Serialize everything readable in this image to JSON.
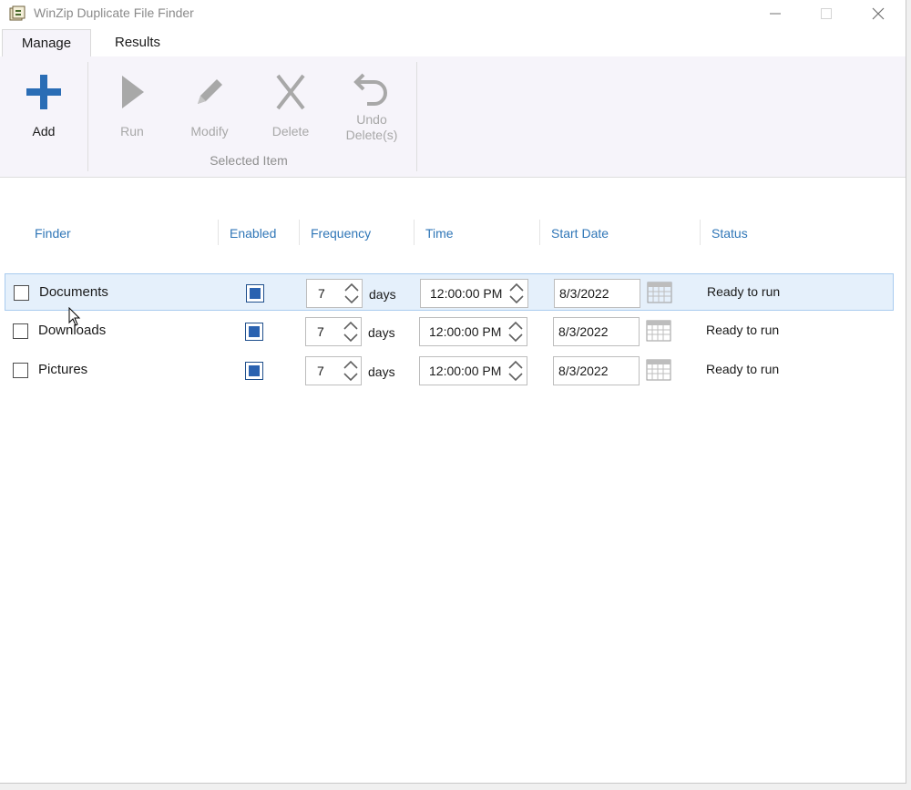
{
  "window": {
    "title": "WinZip Duplicate File Finder"
  },
  "tabs": [
    {
      "label": "Manage",
      "selected": true
    },
    {
      "label": "Results",
      "selected": false
    }
  ],
  "ribbon": {
    "add": {
      "label": "Add",
      "icon": "plus-icon",
      "color": "#2a6db5"
    },
    "run": {
      "label": "Run",
      "icon": "play-icon",
      "enabled": false
    },
    "modify": {
      "label": "Modify",
      "icon": "pencil-icon",
      "enabled": false
    },
    "delete": {
      "label": "Delete",
      "icon": "x-icon",
      "enabled": false
    },
    "undo": {
      "label": "Undo Delete(s)",
      "icon": "undo-icon",
      "enabled": false
    },
    "group_label": "Selected Item"
  },
  "columns": [
    "Finder",
    "Enabled",
    "Frequency",
    "Time",
    "Start Date",
    "Status"
  ],
  "rows": [
    {
      "name": "Documents",
      "enabled": true,
      "frequency": "7",
      "unit": "days",
      "time": "12:00:00 PM",
      "start_date": "8/3/2022",
      "status": "Ready to run",
      "selected": true
    },
    {
      "name": "Downloads",
      "enabled": true,
      "frequency": "7",
      "unit": "days",
      "time": "12:00:00 PM",
      "start_date": "8/3/2022",
      "status": "Ready to run",
      "selected": false
    },
    {
      "name": "Pictures",
      "enabled": true,
      "frequency": "7",
      "unit": "days",
      "time": "12:00:00 PM",
      "start_date": "8/3/2022",
      "status": "Ready to run",
      "selected": false
    }
  ],
  "colors": {
    "header_text": "#2f76b7",
    "selection": "#e5f0fb",
    "checkbox_fill": "#2a62b0"
  }
}
